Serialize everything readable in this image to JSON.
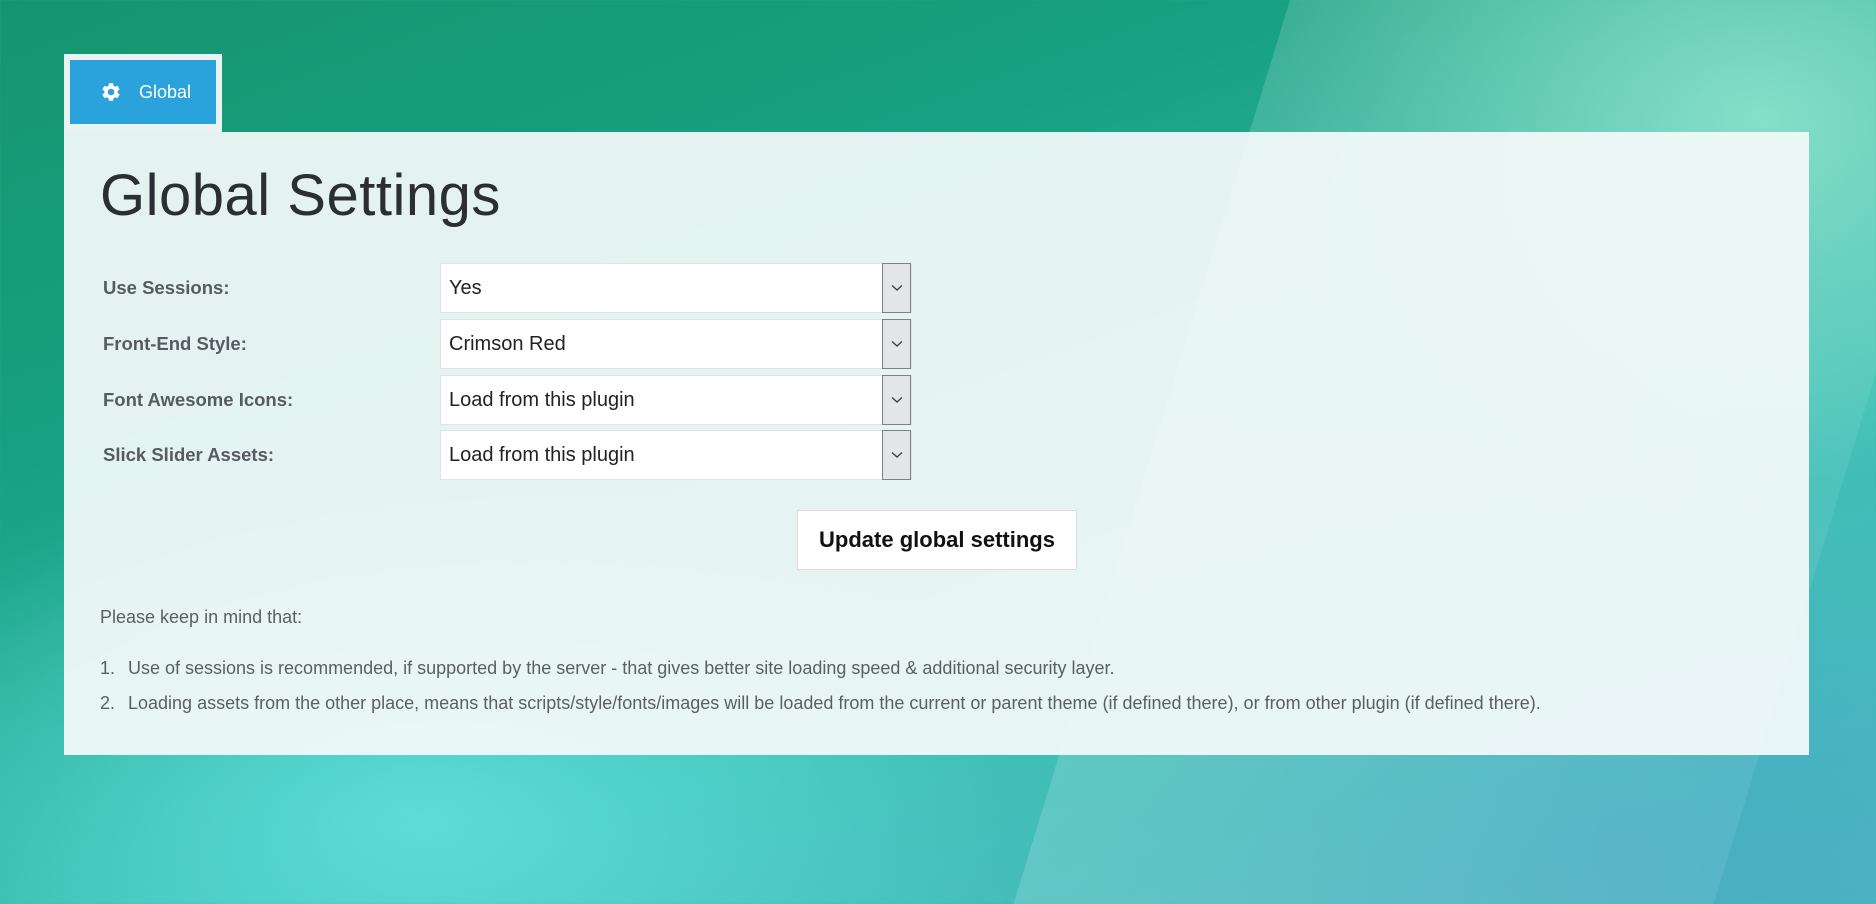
{
  "tab": {
    "label": "Global",
    "icon": "gear-icon"
  },
  "panel": {
    "title": "Global Settings",
    "fields": [
      {
        "label": "Use Sessions:",
        "value": "Yes"
      },
      {
        "label": "Front-End Style:",
        "value": "Crimson Red"
      },
      {
        "label": "Font Awesome Icons:",
        "value": "Load from this plugin"
      },
      {
        "label": "Slick Slider Assets:",
        "value": "Load from this plugin"
      }
    ],
    "submit_label": "Update global settings",
    "note_intro": "Please keep in mind that:",
    "notes": [
      {
        "num": "1.",
        "text": "Use of sessions is recommended, if supported by the server - that gives better site loading speed & additional security layer."
      },
      {
        "num": "2.",
        "text": "Loading assets from the other place, means that scripts/style/fonts/images will be loaded from the current or parent theme (if defined there), or from other plugin (if defined there)."
      }
    ]
  },
  "colors": {
    "tab_accent": "#2aa2dc",
    "background_teal": "#17a182"
  }
}
